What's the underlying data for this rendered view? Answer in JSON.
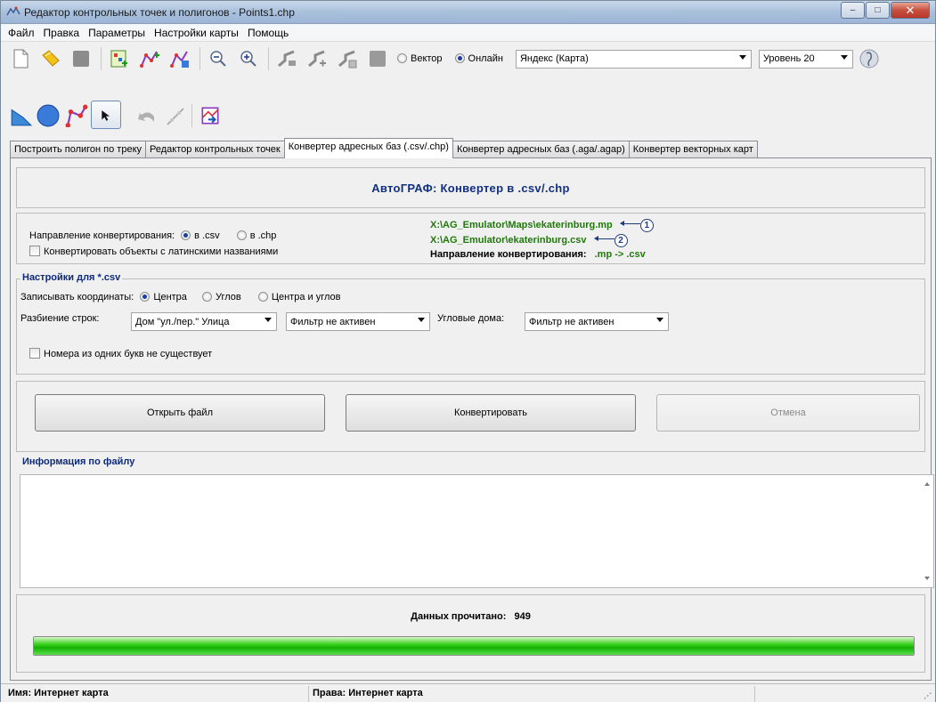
{
  "window": {
    "title": "Редактор контрольных точек и полигонов - Points1.chp",
    "minimize": "–",
    "maximize": "□",
    "close": "✕"
  },
  "menu": [
    "Файл",
    "Правка",
    "Параметры",
    "Настройки карты",
    "Помощь"
  ],
  "toolbar": {
    "radio_vector": "Вектор",
    "radio_online": "Онлайн",
    "online_selected": true,
    "map_source": "Яндекс (Карта)",
    "zoom_level": "Уровень 20"
  },
  "tabs": [
    "Построить полигон по треку",
    "Редактор контрольных точек",
    "Конвертер адресных баз (.csv/.chp)",
    "Конвертер адресных баз (.aga/.agap)",
    "Конвертер векторных карт"
  ],
  "active_tab_index": 2,
  "header": {
    "title": "АвтоГРАФ: Конвертер в .csv/.chp"
  },
  "direction": {
    "label": "Направление конвертирования:",
    "opt_csv": "в .csv",
    "opt_chp": "в .chp",
    "latin_checkbox": "Конвертировать объекты с латинскими названиями",
    "path_source": "X:\\AG_Emulator\\Maps\\ekaterinburg.mp",
    "path_target": "X:\\AG_Emulator\\ekaterinburg.csv",
    "callout1": "1",
    "callout2": "2",
    "dir_label": "Направление конвертирования:",
    "dir_value": ".mp -> .csv"
  },
  "settings": {
    "legend": "Настройки для *.csv",
    "coords_label": "Записывать координаты:",
    "coords_center": "Центра",
    "coords_corners": "Углов",
    "coords_both": "Центра и углов",
    "split_label": "Разбиение строк:",
    "split_value": "Дом \"ул./пер.\" Улица",
    "filter_value": "Фильтр не активен",
    "corner_label": "Угловые дома:",
    "corner_value": "Фильтр не активен",
    "letters_checkbox": "Номера из одних букв не существует"
  },
  "buttons": {
    "open": "Открыть файл",
    "convert": "Конвертировать",
    "cancel": "Отмена"
  },
  "info": {
    "legend": "Информация по файлу"
  },
  "progress": {
    "label": "Данных прочитано:",
    "count": "949",
    "fraction": 1.0
  },
  "status": {
    "name": "Имя: Интернет карта",
    "rights": "Права: Интернет карта"
  },
  "colors": {
    "accent_title": "#123080",
    "path_green": "#1f7a0a",
    "progress_green": "#14b005"
  }
}
